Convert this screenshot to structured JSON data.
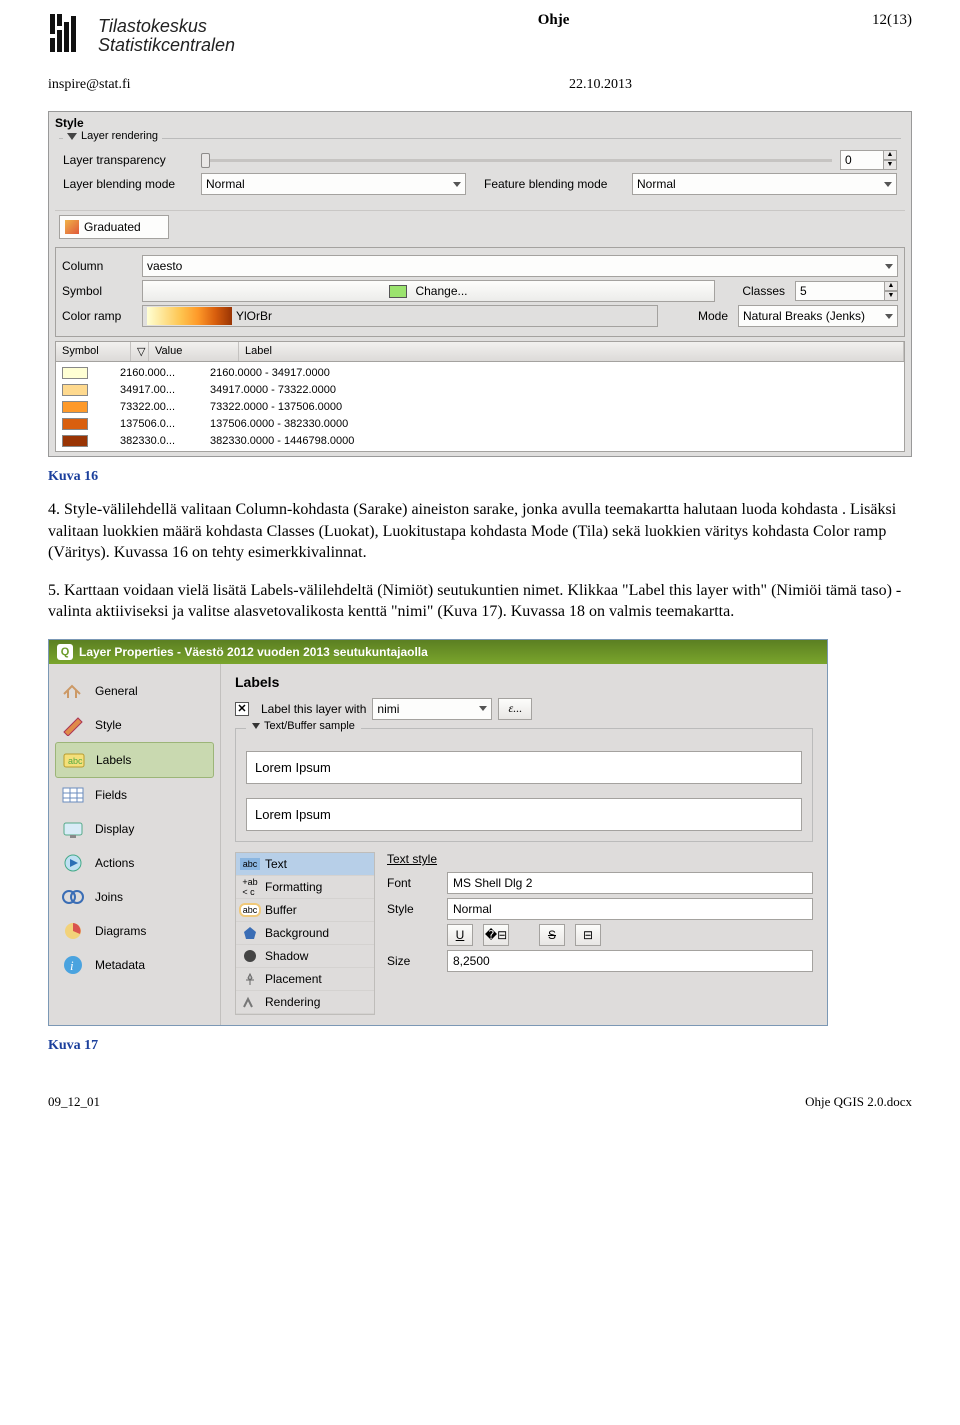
{
  "header": {
    "logo_line1": "Tilastokeskus",
    "logo_line2": "Statistikcentralen",
    "center": "Ohje",
    "right": "12(13)",
    "email": "inspire@stat.fi",
    "date": "22.10.2013"
  },
  "screenshot1": {
    "title": "Style",
    "group_label": "Layer rendering",
    "transparency_label": "Layer transparency",
    "transparency_value": "0",
    "layer_blend_label": "Layer blending mode",
    "layer_blend_value": "Normal",
    "feature_blend_label": "Feature blending mode",
    "feature_blend_value": "Normal",
    "renderer": "Graduated",
    "column_label": "Column",
    "column_value": "vaesto",
    "symbol_label": "Symbol",
    "change_label": "Change...",
    "classes_label": "Classes",
    "classes_value": "5",
    "ramp_label": "Color ramp",
    "ramp_name": "YlOrBr",
    "mode_label": "Mode",
    "mode_value": "Natural Breaks (Jenks)",
    "th_symbol": "Symbol",
    "th_value": "Value",
    "th_label": "Label",
    "rows": [
      {
        "color": "#ffffd4",
        "value": "2160.000...",
        "label": "2160.0000 - 34917.0000"
      },
      {
        "color": "#fed98e",
        "value": "34917.00...",
        "label": "34917.0000 - 73322.0000"
      },
      {
        "color": "#fe9929",
        "value": "73322.00...",
        "label": "73322.0000 - 137506.0000"
      },
      {
        "color": "#d95f0e",
        "value": "137506.0...",
        "label": "137506.0000 - 382330.0000"
      },
      {
        "color": "#993404",
        "value": "382330.0...",
        "label": "382330.0000 - 1446798.0000"
      }
    ]
  },
  "caption1": "Kuva 16",
  "para4": "4. Style-välilehdellä valitaan Column-kohdasta (Sarake) aineiston sarake, jonka avulla teemakartta halutaan luoda kohdasta . Lisäksi valitaan luokkien määrä kohdasta Classes (Luokat), Luokitustapa kohdasta Mode (Tila) sekä luokkien väritys kohdasta Color ramp (Väritys). Kuvassa 16 on tehty esimerkkivalinnat.",
  "para5": "5. Karttaan voidaan vielä lisätä Labels-välilehdeltä (Nimiöt) seutukuntien nimet. Klikkaa \"Label this layer with\" (Nimiöi tämä taso) -valinta aktiiviseksi ja valitse alasvetovalikosta kenttä \"nimi\" (Kuva 17). Kuvassa 18 on valmis teemakartta.",
  "screenshot2": {
    "title": "Layer Properties - Väestö 2012 vuoden 2013 seutukuntajaolla",
    "side": [
      "General",
      "Style",
      "Labels",
      "Fields",
      "Display",
      "Actions",
      "Joins",
      "Diagrams",
      "Metadata"
    ],
    "main_title": "Labels",
    "chk_label": "Label this layer with",
    "field_value": "nimi",
    "eps": "ε...",
    "sample_group": "Text/Buffer sample",
    "sample_text": "Lorem Ipsum",
    "sample_text2": "Lorem Ipsum",
    "subtabs": [
      "Text",
      "Formatting",
      "Buffer",
      "Background",
      "Shadow",
      "Placement",
      "Rendering"
    ],
    "textstyle_title": "Text style",
    "font_label": "Font",
    "font_value": "MS Shell Dlg 2",
    "style_label": "Style",
    "style_value": "Normal",
    "size_label": "Size",
    "size_value": "8,2500",
    "u_btn": "U",
    "s_btn": "S"
  },
  "caption2": "Kuva 17",
  "footer": {
    "left": "09_12_01",
    "right": "Ohje QGIS 2.0.docx"
  }
}
